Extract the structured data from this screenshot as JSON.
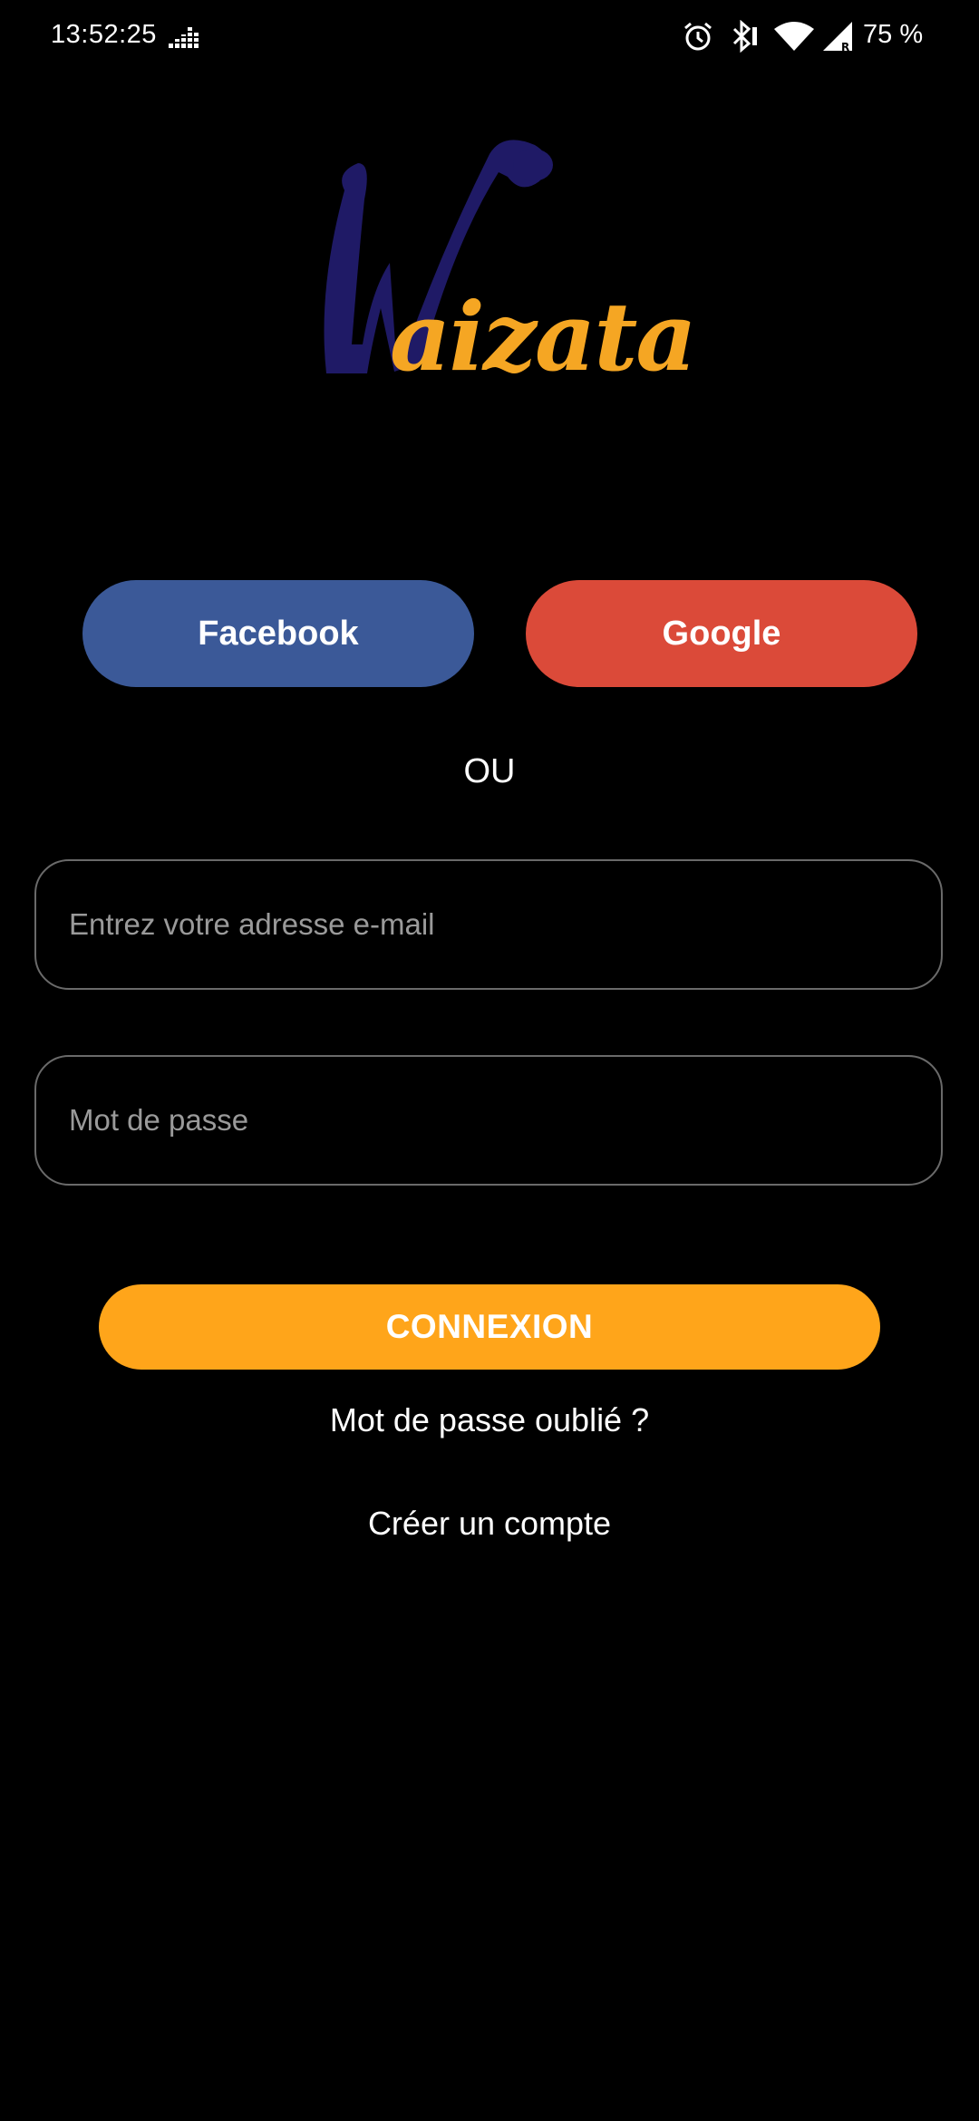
{
  "status_bar": {
    "time": "13:52:25",
    "battery": "75 %",
    "icons": [
      "equalizer-icon",
      "alarm-icon",
      "bluetooth-icon",
      "wifi-icon",
      "signal-icon"
    ]
  },
  "logo": {
    "text": "aizata",
    "colors": {
      "w": "#1f1a66",
      "text": "#f5a623"
    }
  },
  "social": {
    "facebook_label": "Facebook",
    "google_label": "Google",
    "facebook_color": "#3b5998",
    "google_color": "#db4a39"
  },
  "separator": "OU",
  "form": {
    "email_placeholder": "Entrez votre adresse e-mail",
    "email_value": "",
    "password_placeholder": "Mot de passe",
    "password_value": ""
  },
  "actions": {
    "login_label": "CONNEXION",
    "login_color": "#ffa51a",
    "forgot_label": "Mot de passe oublié ?",
    "create_label": "Créer un compte"
  }
}
